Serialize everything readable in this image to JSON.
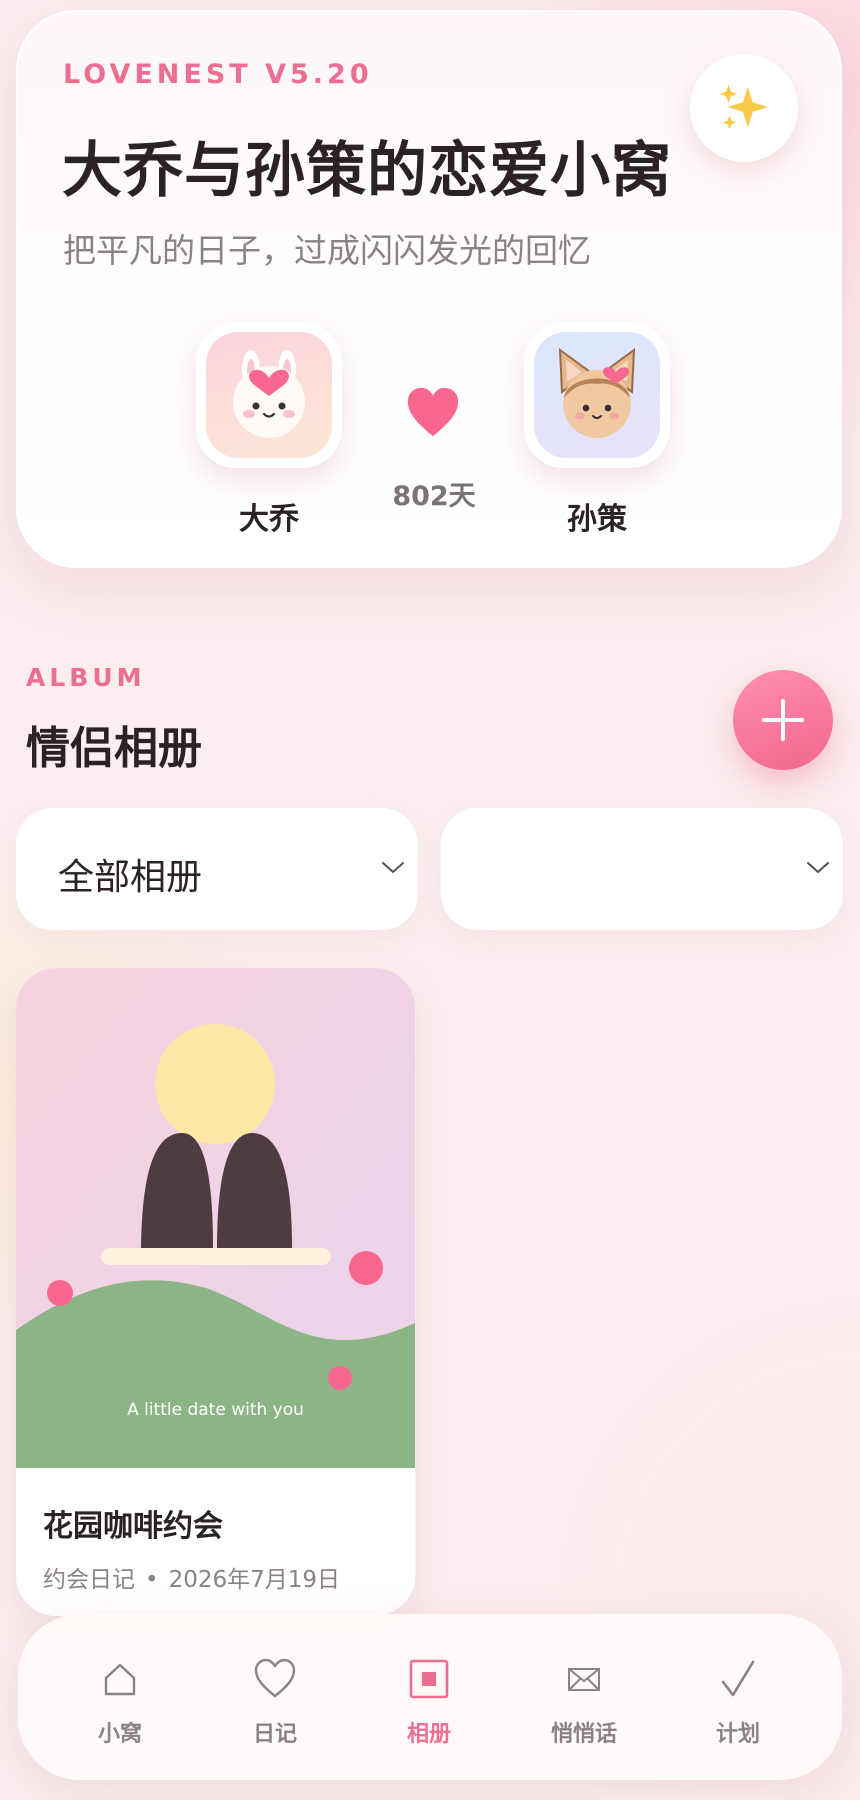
{
  "header": {
    "version": "LOVENEST V5.20",
    "title": "大乔与孙策的恋爱小窝",
    "subtitle": "把平凡的日子，过成闪闪发光的回忆",
    "sparkle_button_icon": "sparkles-icon",
    "partners": {
      "left_name": "大乔",
      "right_name": "孙策",
      "days_together": "802天"
    }
  },
  "album_section": {
    "tag": "ALBUM",
    "title": "情侣相册",
    "add_button_icon": "plus-icon",
    "filters": [
      {
        "selected": "全部相册"
      },
      {
        "selected": ""
      }
    ],
    "cards": [
      {
        "cover_caption": "A little date with you",
        "title": "花园咖啡约会",
        "category": "约会日记",
        "separator": "•",
        "date": "2026年7月19日"
      }
    ]
  },
  "bottom_nav": {
    "items": [
      {
        "label": "小窝",
        "icon": "home-icon",
        "active": false
      },
      {
        "label": "日记",
        "icon": "heart-outline-icon",
        "active": false
      },
      {
        "label": "相册",
        "icon": "album-icon",
        "active": true
      },
      {
        "label": "悄悄话",
        "icon": "envelope-icon",
        "active": false
      },
      {
        "label": "计划",
        "icon": "checkmark-icon",
        "active": false
      }
    ]
  },
  "colors": {
    "accent": "#ec6f92",
    "title_text": "#2b2226",
    "muted_text": "#8a8286",
    "meadow_green": "#8db486",
    "sun_yellow": "#fbe8a6"
  }
}
